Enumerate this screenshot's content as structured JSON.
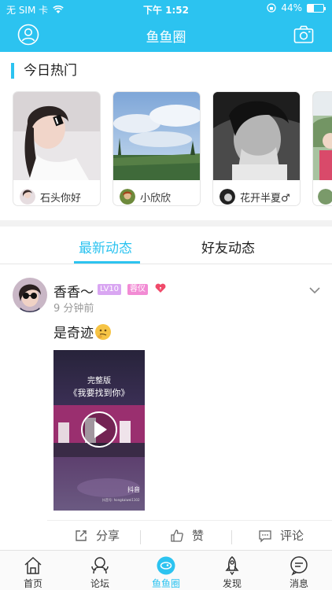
{
  "status_bar": {
    "carrier": "无 SIM 卡",
    "time": "下午 1:52",
    "battery": "44%",
    "battery_level": 0.44
  },
  "nav": {
    "title": "鱼鱼圈"
  },
  "hot": {
    "title": "今日热门",
    "cards": [
      {
        "name": "石头你好"
      },
      {
        "name": "小欣欣"
      },
      {
        "name": "花开半夏♂"
      }
    ]
  },
  "tabs": {
    "latest": "最新动态",
    "friends": "好友动态"
  },
  "post": {
    "username": "香香～",
    "level_badge": "LV10",
    "role_badge": "蓉仪",
    "time": "9 分钟前",
    "text": "是奇迹",
    "video": {
      "badge": "完整版",
      "title": "《我要找到你》",
      "watermark": "抖音",
      "account": "抖音号: hongkaiwei1102"
    },
    "actions": {
      "share": "分享",
      "like": "赞",
      "comment": "评论"
    }
  },
  "tab_bar": {
    "items": [
      {
        "label": "首页"
      },
      {
        "label": "论坛"
      },
      {
        "label": "鱼鱼圈"
      },
      {
        "label": "发现"
      },
      {
        "label": "消息"
      }
    ]
  },
  "colors": {
    "accent": "#2cc3f0",
    "level_badge": "#d9a6f2",
    "role_badge": "#f28bd4"
  }
}
